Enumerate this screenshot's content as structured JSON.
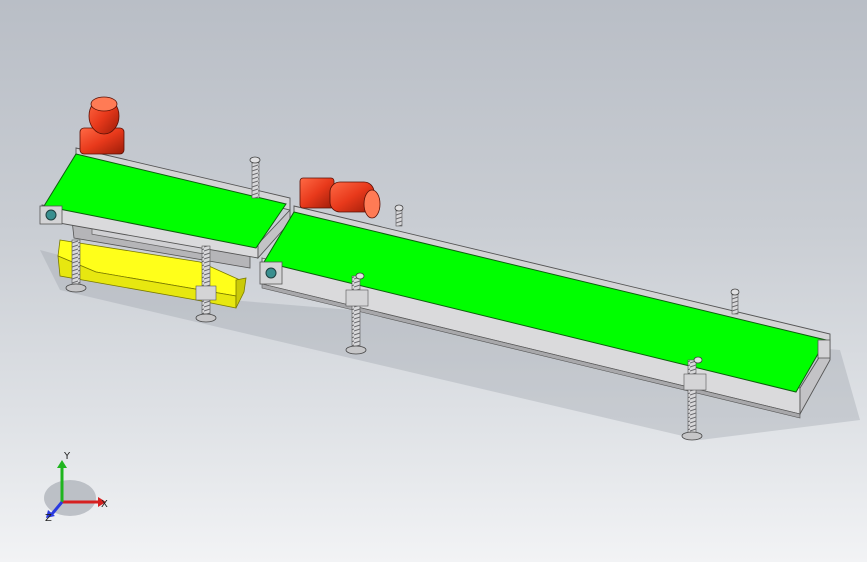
{
  "triad": {
    "x_label": "X",
    "y_label": "Y",
    "z_label": "Z",
    "x_color": "#d62020",
    "y_color": "#1fb51f",
    "z_color": "#2a3ae0"
  },
  "colors": {
    "belt": "#00ff00",
    "frame": "#d8d8da",
    "frame_dark": "#8a8a8e",
    "motor": "#e8391b",
    "stand": "#ffff1a",
    "background_top": "#b9bec6",
    "background_bottom": "#f2f3f5"
  }
}
